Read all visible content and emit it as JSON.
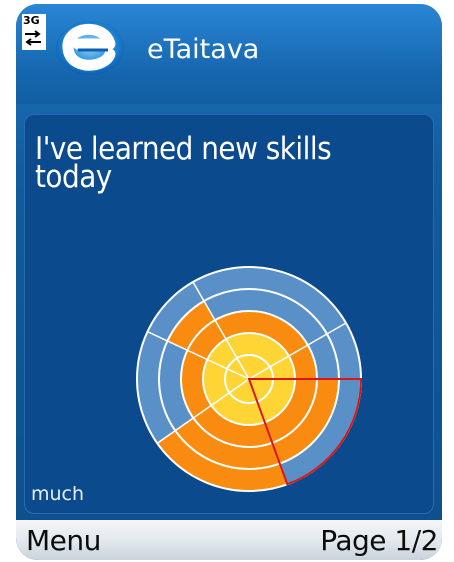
{
  "status": {
    "network": "3G"
  },
  "app": {
    "title": "eTaitava",
    "logo_icon": "etaitava-e-logo-icon"
  },
  "question": {
    "text": "I've learned new skills today"
  },
  "scale": {
    "min_label": "much"
  },
  "softkeys": {
    "left": "Menu",
    "right": "Page 1/2"
  },
  "colors": {
    "background": "#0b4a8c",
    "ring_blue": "#5a90c8",
    "orange": "#f98c10",
    "yellow": "#ffd020",
    "selection": "#d81818"
  },
  "chart_data": {
    "type": "polar-selector",
    "rings": 5,
    "sectors": 6,
    "selection_marker": "lower-right sector"
  }
}
